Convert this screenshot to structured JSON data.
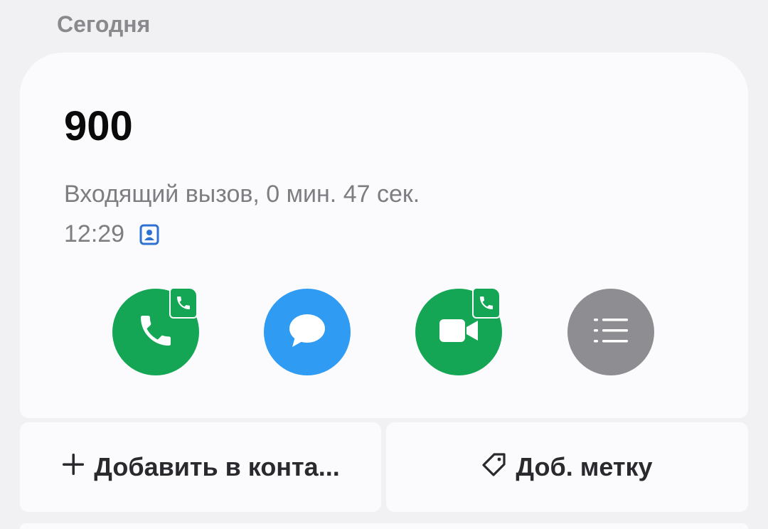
{
  "section": {
    "label": "Сегодня"
  },
  "call": {
    "number": "900",
    "description": "Входящий вызов, 0 мин. 47 сек.",
    "time": "12:29",
    "sim_icon": "contact-card-icon"
  },
  "actions": [
    {
      "name": "call",
      "icon": "phone-icon",
      "color": "#14a655",
      "badge": "phone-badge-icon"
    },
    {
      "name": "message",
      "icon": "chat-bubble-icon",
      "color": "#2f9bf2"
    },
    {
      "name": "video-call",
      "icon": "video-camera-icon",
      "color": "#14a655",
      "badge": "phone-badge-icon"
    },
    {
      "name": "details",
      "icon": "list-icon",
      "color": "#8e8e92"
    }
  ],
  "buttons": {
    "add_contact": {
      "icon": "plus-icon",
      "label": "Добавить в конта..."
    },
    "add_tag": {
      "icon": "tag-icon",
      "label": "Доб. метку"
    }
  }
}
